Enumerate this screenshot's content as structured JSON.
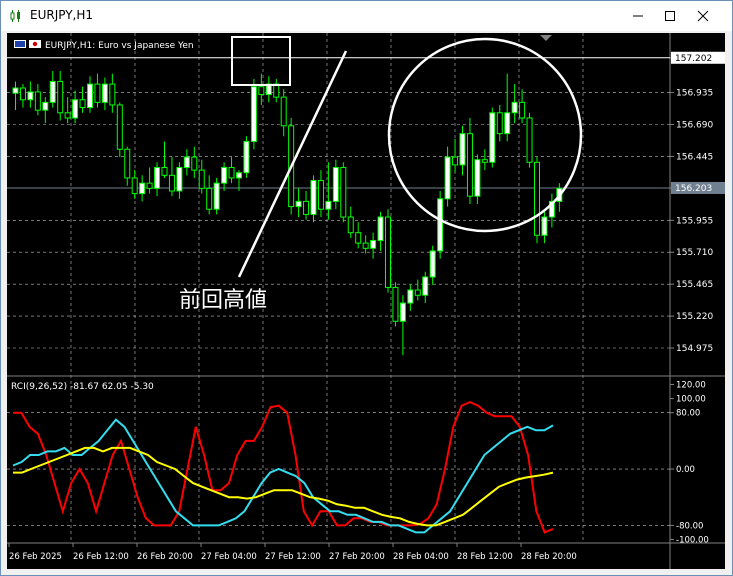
{
  "window": {
    "title": "EURJPY,H1",
    "minimize_icon": "minimize-icon",
    "maximize_icon": "maximize-icon",
    "close_icon": "close-icon"
  },
  "chart": {
    "header": "EURJPY,H1: Euro vs Japanese Yen",
    "current_price": "156.203",
    "top_line_price": "157.202",
    "annotation": "前回高値",
    "price_ticks": [
      "157.202",
      "156.935",
      "156.690",
      "156.445",
      "156.203",
      "155.955",
      "155.710",
      "155.465",
      "155.220",
      "154.975"
    ],
    "time_labels": [
      "26 Feb 2025",
      "26 Feb 12:00",
      "26 Feb 20:00",
      "27 Feb 04:00",
      "27 Feb 12:00",
      "27 Feb 20:00",
      "28 Feb 04:00",
      "28 Feb 12:00",
      "28 Feb 20:00"
    ],
    "colors": {
      "background": "#000000",
      "bull_body": "#ffffff",
      "bear_body": "#000000",
      "candle_outline": "#00ff00",
      "grid": "#c0c0c0",
      "annotation": "#ffffff"
    }
  },
  "indicator": {
    "label": "RCI(9,26,52) -81.67 62.05 -5.30",
    "ticks": [
      "120.00",
      "100.00",
      "80.00",
      "0.00",
      "-80.00",
      "-100.00"
    ],
    "series_colors": {
      "short": "#ff0000",
      "middle": "#33ddee",
      "long": "#ffff00"
    }
  },
  "chart_data": {
    "type": "line",
    "price_series": {
      "kind": "candlestick",
      "symbol": "EURJPY",
      "timeframe": "H1",
      "ylim": [
        154.86,
        157.3
      ],
      "candles": [
        [
          156.93,
          157.02,
          156.8,
          156.97
        ],
        [
          156.97,
          157.0,
          156.82,
          156.88
        ],
        [
          156.88,
          157.02,
          156.82,
          156.94
        ],
        [
          156.94,
          157.0,
          156.76,
          156.8
        ],
        [
          156.8,
          156.9,
          156.7,
          156.86
        ],
        [
          156.86,
          157.1,
          156.82,
          157.02
        ],
        [
          157.02,
          157.1,
          156.72,
          156.78
        ],
        [
          156.78,
          156.9,
          156.7,
          156.74
        ],
        [
          156.74,
          156.95,
          156.7,
          156.88
        ],
        [
          156.88,
          156.98,
          156.78,
          156.82
        ],
        [
          156.82,
          157.06,
          156.78,
          157.0
        ],
        [
          157.0,
          157.08,
          156.82,
          156.86
        ],
        [
          156.86,
          157.05,
          156.8,
          157.0
        ],
        [
          157.0,
          157.08,
          156.78,
          156.84
        ],
        [
          156.84,
          156.86,
          156.44,
          156.5
        ],
        [
          156.5,
          156.52,
          156.22,
          156.28
        ],
        [
          156.28,
          156.34,
          156.12,
          156.16
        ],
        [
          156.16,
          156.3,
          156.1,
          156.24
        ],
        [
          156.24,
          156.36,
          156.16,
          156.2
        ],
        [
          156.2,
          156.4,
          156.14,
          156.36
        ],
        [
          156.36,
          156.56,
          156.28,
          156.3
        ],
        [
          156.3,
          156.44,
          156.14,
          156.18
        ],
        [
          156.18,
          156.4,
          156.12,
          156.36
        ],
        [
          156.36,
          156.5,
          156.3,
          156.44
        ],
        [
          156.44,
          156.52,
          156.28,
          156.34
        ],
        [
          156.34,
          156.42,
          156.16,
          156.2
        ],
        [
          156.2,
          156.3,
          156.0,
          156.04
        ],
        [
          156.04,
          156.28,
          156.0,
          156.24
        ],
        [
          156.24,
          156.4,
          156.18,
          156.36
        ],
        [
          156.36,
          156.44,
          156.24,
          156.28
        ],
        [
          156.28,
          156.34,
          156.18,
          156.32
        ],
        [
          156.32,
          156.6,
          156.28,
          156.56
        ],
        [
          156.56,
          157.04,
          156.5,
          156.98
        ],
        [
          156.98,
          157.08,
          156.84,
          156.92
        ],
        [
          156.92,
          157.06,
          156.86,
          157.0
        ],
        [
          157.0,
          157.04,
          156.86,
          156.9
        ],
        [
          156.9,
          156.96,
          156.6,
          156.68
        ],
        [
          156.68,
          156.74,
          156.0,
          156.06
        ],
        [
          156.06,
          156.2,
          155.98,
          156.1
        ],
        [
          156.1,
          156.18,
          155.96,
          156.0
        ],
        [
          156.0,
          156.3,
          155.94,
          156.26
        ],
        [
          156.26,
          156.34,
          155.98,
          156.04
        ],
        [
          156.04,
          156.4,
          155.96,
          156.1
        ],
        [
          156.1,
          156.42,
          156.04,
          156.36
        ],
        [
          156.36,
          156.4,
          155.94,
          155.98
        ],
        [
          155.98,
          156.06,
          155.82,
          155.86
        ],
        [
          155.86,
          155.94,
          155.74,
          155.78
        ],
        [
          155.78,
          155.84,
          155.7,
          155.74
        ],
        [
          155.74,
          155.86,
          155.66,
          155.8
        ],
        [
          155.8,
          156.02,
          155.72,
          155.98
        ],
        [
          155.98,
          156.04,
          155.4,
          155.44
        ],
        [
          155.44,
          155.48,
          155.14,
          155.18
        ],
        [
          155.18,
          155.38,
          154.92,
          155.32
        ],
        [
          155.32,
          155.46,
          155.26,
          155.42
        ],
        [
          155.42,
          155.5,
          155.34,
          155.38
        ],
        [
          155.38,
          155.56,
          155.32,
          155.52
        ],
        [
          155.52,
          155.76,
          155.46,
          155.72
        ],
        [
          155.72,
          156.18,
          155.66,
          156.12
        ],
        [
          156.12,
          156.52,
          156.06,
          156.44
        ],
        [
          156.44,
          156.58,
          156.32,
          156.38
        ],
        [
          156.38,
          156.68,
          156.3,
          156.62
        ],
        [
          156.62,
          156.74,
          156.08,
          156.14
        ],
        [
          156.14,
          156.46,
          156.08,
          156.42
        ],
        [
          156.42,
          156.5,
          156.34,
          156.4
        ],
        [
          156.4,
          156.82,
          156.36,
          156.78
        ],
        [
          156.78,
          156.84,
          156.56,
          156.62
        ],
        [
          156.62,
          157.08,
          156.56,
          156.78
        ],
        [
          156.78,
          157.0,
          156.7,
          156.86
        ],
        [
          156.86,
          156.96,
          156.7,
          156.74
        ],
        [
          156.74,
          156.78,
          156.36,
          156.4
        ],
        [
          156.4,
          156.44,
          155.78,
          155.84
        ],
        [
          155.84,
          156.04,
          155.78,
          155.98
        ],
        [
          155.98,
          156.16,
          155.9,
          156.1
        ],
        [
          156.1,
          156.24,
          156.02,
          156.2
        ]
      ]
    },
    "rci_series": {
      "ylim": [
        -105,
        125
      ],
      "series": [
        {
          "name": "RCI 9",
          "color": "#ff0000",
          "values": [
            80,
            80,
            60,
            50,
            20,
            -20,
            -60,
            -20,
            0,
            -20,
            -60,
            -20,
            20,
            40,
            0,
            -40,
            -70,
            -80,
            -80,
            -80,
            -60,
            0,
            60,
            20,
            -30,
            -30,
            -20,
            20,
            40,
            40,
            60,
            88,
            90,
            80,
            20,
            -60,
            -80,
            -60,
            -60,
            -80,
            -80,
            -70,
            -70,
            -75,
            -75,
            -80,
            -80,
            -80,
            -80,
            -78,
            -70,
            -50,
            0,
            60,
            90,
            95,
            90,
            80,
            75,
            75,
            75,
            60,
            20,
            -60,
            -90,
            -85
          ]
        },
        {
          "name": "RCI 26",
          "color": "#33ddee",
          "values": [
            5,
            10,
            20,
            20,
            25,
            25,
            30,
            20,
            20,
            30,
            40,
            55,
            70,
            60,
            40,
            20,
            0,
            -20,
            -40,
            -60,
            -70,
            -80,
            -80,
            -80,
            -80,
            -75,
            -70,
            -60,
            -40,
            -20,
            -5,
            0,
            -5,
            -10,
            -20,
            -40,
            -50,
            -60,
            -60,
            -65,
            -65,
            -70,
            -75,
            -75,
            -80,
            -80,
            -85,
            -90,
            -90,
            -80,
            -70,
            -60,
            -40,
            -20,
            0,
            20,
            30,
            40,
            50,
            55,
            60,
            55,
            55,
            62
          ]
        },
        {
          "name": "RCI 52",
          "color": "#ffff00",
          "values": [
            -5,
            -5,
            0,
            5,
            10,
            15,
            20,
            25,
            30,
            30,
            25,
            30,
            30,
            30,
            25,
            20,
            10,
            5,
            0,
            -10,
            -20,
            -25,
            -30,
            -35,
            -40,
            -40,
            -42,
            -40,
            -35,
            -30,
            -30,
            -30,
            -35,
            -40,
            -42,
            -45,
            -50,
            -52,
            -55,
            -55,
            -60,
            -65,
            -68,
            -70,
            -75,
            -78,
            -80,
            -80,
            -75,
            -70,
            -65,
            -55,
            -45,
            -35,
            -25,
            -20,
            -15,
            -12,
            -10,
            -8,
            -5
          ]
        }
      ]
    }
  }
}
